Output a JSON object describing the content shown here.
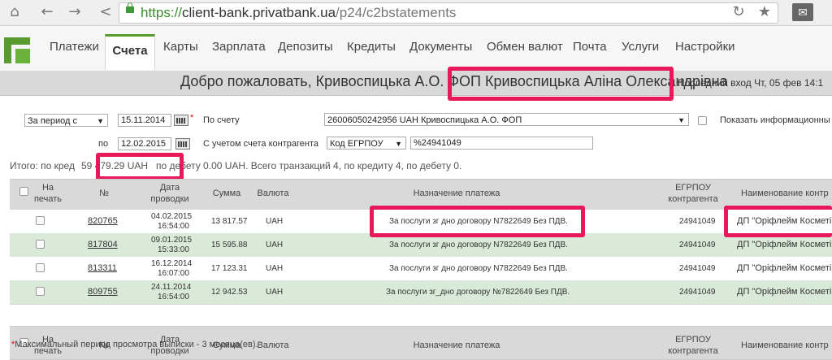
{
  "browser": {
    "url_scheme": "https://",
    "url_host": "client-bank.privatbank.ua",
    "url_path": "/p24/c2bstatements"
  },
  "nav": {
    "tabs": [
      "Платежи",
      "Счета",
      "Карты",
      "Зарплата",
      "Депозиты",
      "Кредиты",
      "Документы",
      "Обмен валют",
      "Почта",
      "Услуги",
      "Настройки"
    ],
    "active_tab": "Счета"
  },
  "welcome": {
    "greeting": "Добро пожаловать, Кривоспицька А.О. ФОП",
    "name": "Кривоспицька Аліна Олександрівна",
    "last_login": "Последний вход Чт, 05 фев 14:1"
  },
  "filters": {
    "period_select": "За период с",
    "date_from": "15.11.2014",
    "account_label": "По счету",
    "account_value": "26006050242956 UAH Кривоспицька А.О. ФОП",
    "show_info_label": "Показать информационны",
    "to_label": "по",
    "date_to": "12.02.2015",
    "counterparty_label": "С учетом счета контрагента",
    "counterparty_type": "Код ЕГРПОУ",
    "counterparty_value": "%24941049"
  },
  "summary": {
    "prefix": "Итого: по кред",
    "amount": "59 479.29 UAH",
    "suffix": "по дебету 0.00 UAH. Всего транзакций 4, по кредиту 4, по дебету 0."
  },
  "table": {
    "headers": {
      "print": "На печать",
      "num": "№",
      "date": "Дата проводки",
      "sum": "Сумма",
      "currency": "Валюта",
      "purpose": "Назначение платежа",
      "egrpou": "ЕГРПОУ контрагента",
      "name": "Наименование контр"
    },
    "rows": [
      {
        "num": "820765",
        "date": "04.02.2015",
        "time": "16:54:00",
        "sum": "13 817.57",
        "currency": "UAH",
        "purpose": "За послуги зг дно договору N7822649 Без ПДВ.",
        "egrpou": "24941049",
        "name": "ДП \"Оріфлейм Косметікс"
      },
      {
        "num": "817804",
        "date": "09.01.2015",
        "time": "15:33:00",
        "sum": "15 595.88",
        "currency": "UAH",
        "purpose": "За послуги зг дно договору N7822649 Без ПДВ.",
        "egrpou": "24941049",
        "name": "ДП \"Оріфлейм Косметікс"
      },
      {
        "num": "813311",
        "date": "16.12.2014",
        "time": "16:07:00",
        "sum": "17 123.31",
        "currency": "UAH",
        "purpose": "За послуги зг дно договору N7822649 Без ПДВ.",
        "egrpou": "24941049",
        "name": "ДП \"Оріфлейм Косметікс"
      },
      {
        "num": "809755",
        "date": "24.11.2014",
        "time": "16:54:00",
        "sum": "12 942.53",
        "currency": "UAH",
        "purpose": "За послуги зг_дно договору №7822649 Без ПДВ.",
        "egrpou": "24941049",
        "name": "ДП \"Оріфлейм Косметікс"
      }
    ]
  },
  "footer": {
    "asterisk": "*",
    "text": "Максимальный период просмотра выписки -   3   месяца(ев)."
  },
  "colors": {
    "brand_green": "#5a9b31",
    "highlight": "#e8185b",
    "row_green": "#d9ead8"
  }
}
